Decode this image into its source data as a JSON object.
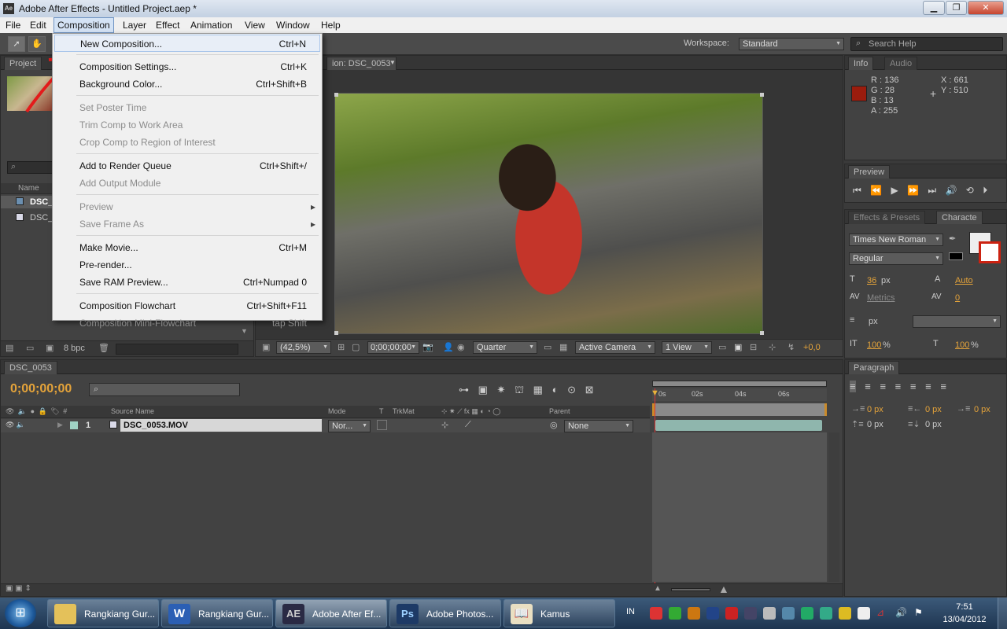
{
  "title": "Adobe After Effects - Untitled Project.aep *",
  "menu": [
    "File",
    "Edit",
    "Composition",
    "Layer",
    "Effect",
    "Animation",
    "View",
    "Window",
    "Help"
  ],
  "active_menu": "Composition",
  "workspace": {
    "label": "Workspace:",
    "value": "Standard"
  },
  "search_help": "Search Help",
  "composition_menu": [
    {
      "label": "New Composition...",
      "shortcut": "Ctrl+N",
      "enabled": true
    },
    {
      "label": "Composition Settings...",
      "shortcut": "Ctrl+K",
      "enabled": true
    },
    {
      "label": "Background Color...",
      "shortcut": "Ctrl+Shift+B",
      "enabled": true
    },
    {
      "label": "Set Poster Time",
      "shortcut": "",
      "enabled": false
    },
    {
      "label": "Trim Comp to Work Area",
      "shortcut": "",
      "enabled": false
    },
    {
      "label": "Crop Comp to Region of Interest",
      "shortcut": "",
      "enabled": false
    },
    {
      "label": "Add to Render Queue",
      "shortcut": "Ctrl+Shift+/",
      "enabled": true
    },
    {
      "label": "Add Output Module",
      "shortcut": "",
      "enabled": false
    },
    {
      "label": "Preview",
      "shortcut": "",
      "enabled": false,
      "submenu": true
    },
    {
      "label": "Save Frame As",
      "shortcut": "",
      "enabled": false,
      "submenu": true
    },
    {
      "label": "Make Movie...",
      "shortcut": "Ctrl+M",
      "enabled": true
    },
    {
      "label": "Pre-render...",
      "shortcut": "",
      "enabled": true
    },
    {
      "label": "Save RAM Preview...",
      "shortcut": "Ctrl+Numpad 0",
      "enabled": true
    },
    {
      "label": "Composition Flowchart",
      "shortcut": "Ctrl+Shift+F11",
      "enabled": true
    },
    {
      "label": "Composition Mini-Flowchart",
      "shortcut": "tap Shift",
      "enabled": false
    }
  ],
  "project": {
    "tab": "Project",
    "col_name": "Name",
    "items": [
      "DSC_",
      "DSC_"
    ],
    "bpc": "8 bpc"
  },
  "comp_viewer": {
    "tab": "ion: DSC_0053",
    "zoom": "(42,5%)",
    "timecode": "0;00;00;00",
    "resolution": "Quarter",
    "camera": "Active Camera",
    "views": "1 View",
    "exposure": "+0,0"
  },
  "info": {
    "tab": "Info",
    "tab2": "Audio",
    "r": "R : 136",
    "g": "G : 28",
    "b": "B : 13",
    "a": "A : 255",
    "x": "X : 661",
    "y": "Y : 510",
    "swatch": "#9a1c0d"
  },
  "preview": {
    "tab": "Preview"
  },
  "character": {
    "tab1": "Effects & Presets",
    "tab2": "Characte",
    "font": "Times New Roman",
    "style": "Regular",
    "size": "36",
    "size_unit": "px",
    "leading": "Auto",
    "kerning": "Metrics",
    "tracking": "0",
    "stroke_unit": "px",
    "vscale": "100",
    "hscale": "100",
    "pct": "%"
  },
  "paragraph": {
    "tab": "Paragraph",
    "values": [
      "0 px",
      "0 px",
      "0 px",
      "0 px",
      "0 px"
    ]
  },
  "timeline": {
    "tab": "DSC_0053",
    "timecode": "0;00;00;00",
    "cols": [
      "Source Name",
      "Mode",
      "T",
      "TrkMat",
      "Parent"
    ],
    "layer": {
      "num": "1",
      "name": "DSC_0053.MOV",
      "mode": "Nor...",
      "parent": "None"
    },
    "ruler": [
      "0s",
      "02s",
      "04s",
      "06s"
    ]
  },
  "taskbar": {
    "items": [
      "Rangkiang Gur...",
      "Rangkiang Gur...",
      "Adobe After Ef...",
      "Adobe Photos...",
      "Kamus"
    ],
    "lang": "IN",
    "time": "7:51",
    "date": "13/04/2012"
  }
}
